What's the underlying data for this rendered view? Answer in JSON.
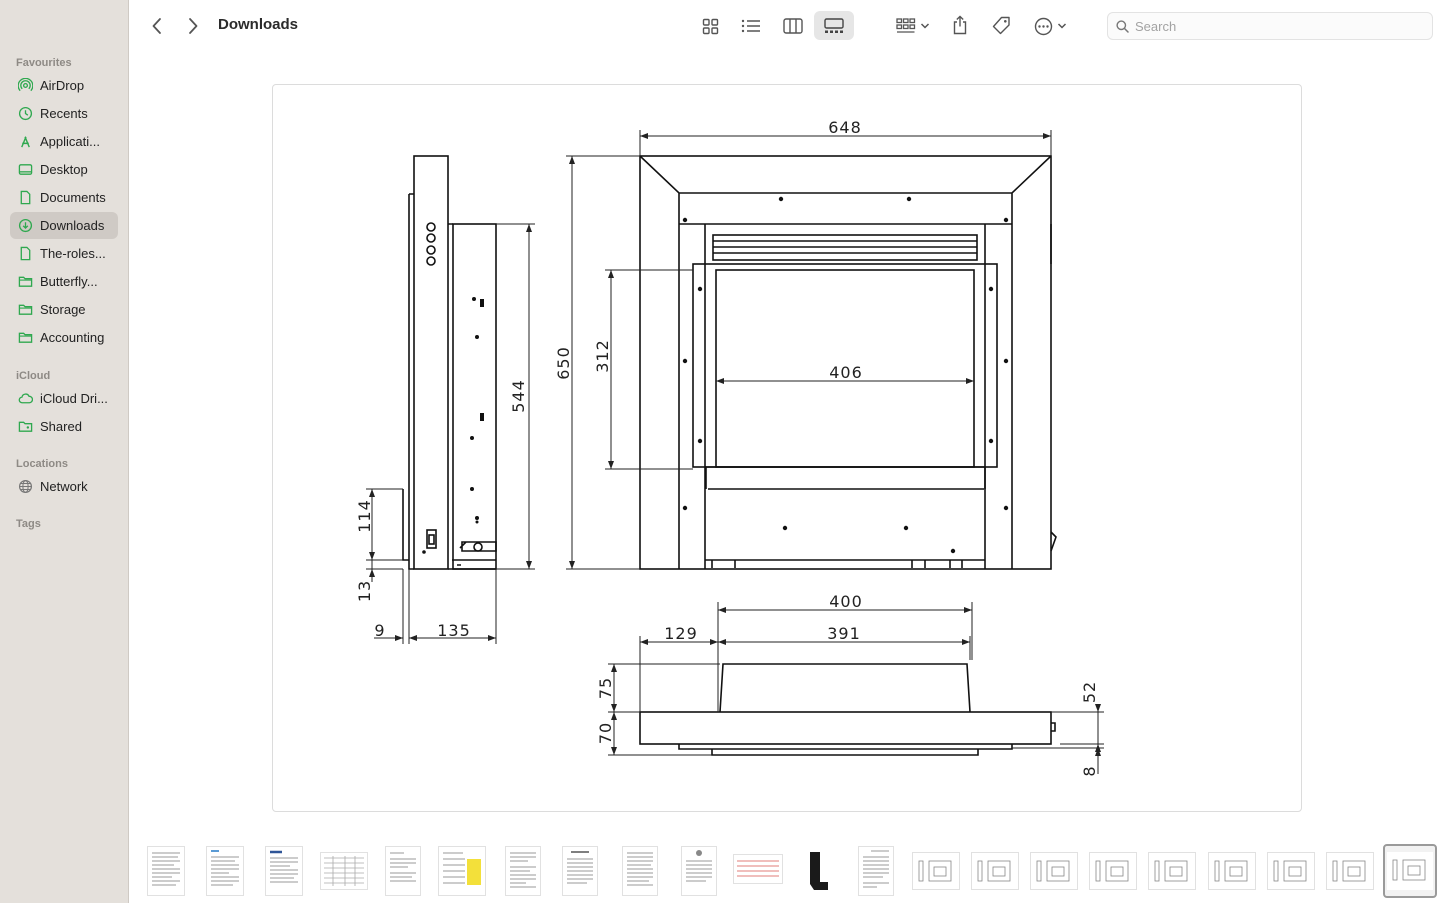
{
  "window": {
    "title": "Downloads"
  },
  "sidebar": {
    "sections": [
      {
        "title": "Favourites"
      },
      {
        "title": "iCloud"
      },
      {
        "title": "Locations"
      },
      {
        "title": "Tags"
      }
    ],
    "items": [
      {
        "label": "AirDrop",
        "icon": "airdrop-icon"
      },
      {
        "label": "Recents",
        "icon": "clock-icon"
      },
      {
        "label": "Applicati...",
        "icon": "applications-icon"
      },
      {
        "label": "Desktop",
        "icon": "desktop-icon"
      },
      {
        "label": "Documents",
        "icon": "document-icon"
      },
      {
        "label": "Downloads",
        "icon": "downloads-icon",
        "active": true
      },
      {
        "label": "The-roles...",
        "icon": "document-icon"
      },
      {
        "label": "Butterfly...",
        "icon": "folder-icon"
      },
      {
        "label": "Storage",
        "icon": "folder-icon"
      },
      {
        "label": "Accounting",
        "icon": "folder-icon"
      },
      {
        "label": "iCloud Dri...",
        "icon": "cloud-icon"
      },
      {
        "label": "Shared",
        "icon": "shared-folder-icon"
      },
      {
        "label": "Network",
        "icon": "globe-icon"
      }
    ]
  },
  "toolbar": {
    "search_placeholder": "Search",
    "view_modes": [
      "icon-view",
      "list-view",
      "column-view",
      "gallery-view"
    ],
    "active_view": "gallery-view"
  },
  "preview": {
    "dimensions": {
      "top_width": "648",
      "total_height": "650",
      "side_height": "544",
      "opening_height": "312",
      "opening_width": "406",
      "low_height": "114",
      "base_offset": "13",
      "offset_9": "9",
      "depth": "135",
      "plan_400": "400",
      "plan_129": "129",
      "plan_391": "391",
      "plan_75": "75",
      "plan_70": "70",
      "plan_52": "52",
      "plan_8": "8"
    }
  },
  "thumbnails": {
    "count": 22,
    "selected_index": 21
  },
  "colors": {
    "accent": "#2fa84f",
    "sidebar_bg": "#e4e0db",
    "selection": "#cfcac5"
  }
}
